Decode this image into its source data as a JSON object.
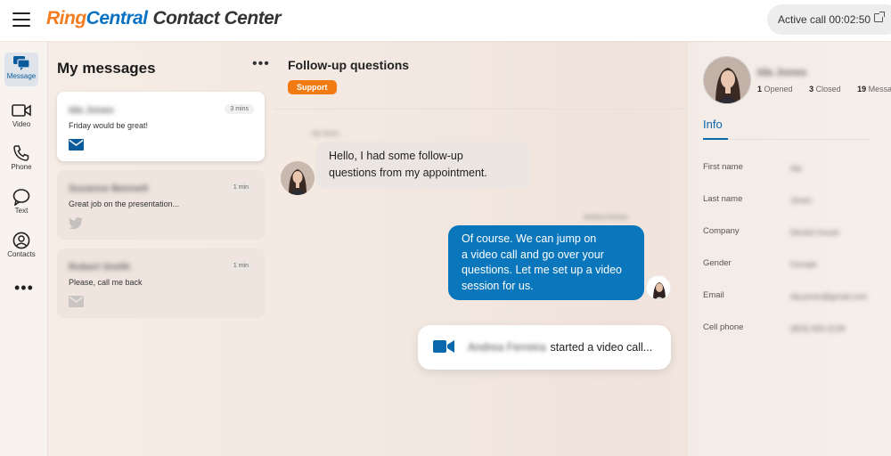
{
  "header": {
    "brand_ring": "Ring",
    "brand_central": "Central",
    "brand_product": "Contact Center",
    "active_call_label": "Active call 00:02:50"
  },
  "leftnav": {
    "items": [
      {
        "label": "Message",
        "icon": "message-icon"
      },
      {
        "label": "Video",
        "icon": "video-icon"
      },
      {
        "label": "Phone",
        "icon": "phone-icon"
      },
      {
        "label": "Text",
        "icon": "text-bubble-icon"
      },
      {
        "label": "Contacts",
        "icon": "contacts-icon"
      }
    ],
    "more": "•••"
  },
  "messages": {
    "title": "My messages",
    "more": "•••",
    "items": [
      {
        "name": "Ida Jones",
        "time": "3 mins",
        "preview": "Friday would be great!",
        "channel": "email-icon"
      },
      {
        "name": "Suzanne Bennett",
        "time": "1 min",
        "preview": "Great job on the presentation...",
        "channel": "twitter-icon"
      },
      {
        "name": "Robert Smith",
        "time": "1 min",
        "preview": "Please, call me back",
        "channel": "email-icon"
      }
    ]
  },
  "conversation": {
    "title": "Follow-up questions",
    "tag": "Support",
    "incoming_sender": "Ida Jones",
    "incoming_text_1": "Hello, I had some follow-up",
    "incoming_text_2": "questions  from my appointment.",
    "outgoing_sender": "Andrea Ferreira",
    "outgoing_text_1": "Of course. We can jump on",
    "outgoing_text_2": "a video call and go over your",
    "outgoing_text_3": "questions. Let me set up a video",
    "outgoing_text_4": "session for us.",
    "video_caller": "Andrea Ferreira",
    "video_text": "started a video call..."
  },
  "profile": {
    "name": "Ida Jones",
    "opened_count": "1",
    "opened_label": "Opened",
    "closed_count": "3",
    "closed_label": "Closed",
    "messages_count": "19",
    "messages_label": "Messages",
    "info_tab": "Info",
    "fields": [
      {
        "label": "First name",
        "value": "Ida"
      },
      {
        "label": "Last name",
        "value": "Jones"
      },
      {
        "label": "Company",
        "value": "Dentist house"
      },
      {
        "label": "Gender",
        "value": "Female"
      },
      {
        "label": "Email",
        "value": "ida.jones@gmail.com"
      },
      {
        "label": "Cell phone",
        "value": "(803) 555-2139"
      }
    ]
  },
  "colors": {
    "brand_orange": "#f47c20",
    "brand_blue": "#0a72c2",
    "bubble_blue": "#0a76bb",
    "tag_orange": "#f27a12"
  }
}
